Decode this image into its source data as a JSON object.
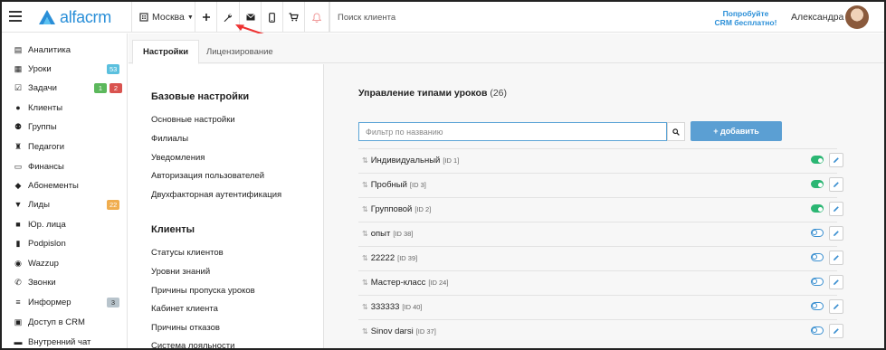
{
  "app": {
    "logo_text": "alfacrm",
    "city": "Москва",
    "search_placeholder": "Поиск клиента",
    "promo_line1": "Попробуйте",
    "promo_line2": "CRM бесплатно!",
    "user_name": "Александра",
    "brand_color": "#2a8fd8"
  },
  "toolbar_icons": [
    "plus-icon",
    "wrench-icon",
    "mail-icon",
    "phone-icon",
    "cart-icon",
    "bell-icon"
  ],
  "sidebar": {
    "items": [
      {
        "label": "Аналитика",
        "icon": "book-icon"
      },
      {
        "label": "Уроки",
        "icon": "calendar-icon",
        "badge": "53",
        "badge_color": "#5bc0de"
      },
      {
        "label": "Задачи",
        "icon": "tasks-icon",
        "badge": "1",
        "badge_color": "#5cb85c",
        "badge2": "2",
        "badge2_color": "#d9534f"
      },
      {
        "label": "Клиенты",
        "icon": "user-icon"
      },
      {
        "label": "Группы",
        "icon": "users-icon"
      },
      {
        "label": "Педагоги",
        "icon": "graduation-cap-icon"
      },
      {
        "label": "Финансы",
        "icon": "money-icon"
      },
      {
        "label": "Абонементы",
        "icon": "tag-icon"
      },
      {
        "label": "Лиды",
        "icon": "funnel-icon",
        "badge": "22",
        "badge_color": "#f0ad4e"
      },
      {
        "label": "Юр. лица",
        "icon": "briefcase-icon"
      },
      {
        "label": "Podpislon",
        "icon": "document-icon"
      },
      {
        "label": "Wazzup",
        "icon": "whatsapp-icon"
      },
      {
        "label": "Звонки",
        "icon": "phone-call-icon"
      },
      {
        "label": "Информер",
        "icon": "list-icon",
        "badge": "3",
        "badge_color": "#b8c4cc"
      },
      {
        "label": "Доступ в CRM",
        "icon": "lock-icon"
      },
      {
        "label": "Внутренний чат",
        "icon": "chat-icon"
      }
    ]
  },
  "tabs": [
    {
      "label": "Настройки",
      "active": true
    },
    {
      "label": "Лицензирование",
      "active": false
    }
  ],
  "settings": {
    "sections": [
      {
        "title": "Базовые настройки",
        "links": [
          "Основные настройки",
          "Филиалы",
          "Уведомления",
          "Авторизация пользователей",
          "Двухфакторная аутентификация"
        ]
      },
      {
        "title": "Клиенты",
        "links": [
          "Статусы клиентов",
          "Уровни знаний",
          "Причины пропуска уроков",
          "Кабинет клиента",
          "Причины отказов",
          "Система лояльности"
        ]
      }
    ]
  },
  "main": {
    "title": "Управление типами уроков",
    "count": "(26)",
    "filter_placeholder": "Фильтр по названию",
    "add_label": "+ добавить",
    "rows": [
      {
        "name": "Индивидуальный",
        "id": "[ID 1]",
        "enabled": true
      },
      {
        "name": "Пробный",
        "id": "[ID 3]",
        "enabled": true
      },
      {
        "name": "Групповой",
        "id": "[ID 2]",
        "enabled": true
      },
      {
        "name": "опыт",
        "id": "[ID 38]",
        "enabled": false
      },
      {
        "name": "22222",
        "id": "[ID 39]",
        "enabled": false
      },
      {
        "name": "Мастер-класс",
        "id": "[ID 24]",
        "enabled": false
      },
      {
        "name": "333333",
        "id": "[ID 40]",
        "enabled": false
      },
      {
        "name": "Sinov darsi",
        "id": "[ID 37]",
        "enabled": false
      }
    ]
  }
}
